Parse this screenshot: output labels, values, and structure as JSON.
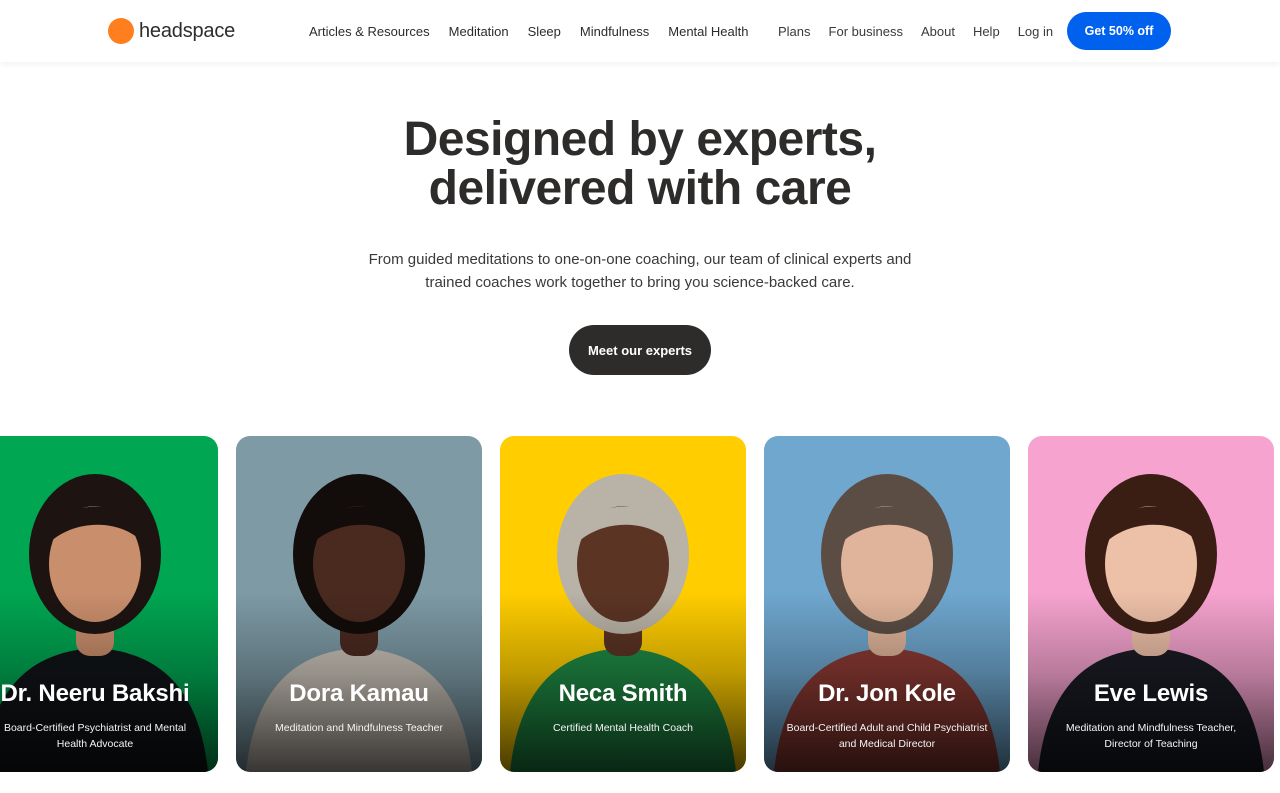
{
  "brand": {
    "name": "headspace",
    "logo_color": "#ff7e1d"
  },
  "nav": {
    "primary": [
      "Articles & Resources",
      "Meditation",
      "Sleep",
      "Mindfulness",
      "Mental Health"
    ],
    "utility": [
      "Plans",
      "For business",
      "About",
      "Help",
      "Log in"
    ],
    "cta_label": "Get 50% off",
    "cta_color": "#0061ef"
  },
  "hero": {
    "title_lines": [
      "Designed by experts,",
      "delivered with care"
    ],
    "subtitle_lines": [
      "From guided meditations to one-on-one coaching, our team of clinical experts and",
      "trained coaches work together to bring you science-backed care."
    ],
    "button_label": "Meet our experts"
  },
  "experts": [
    {
      "name": "Dr. Neeru Bakshi",
      "role_lines": [
        "Board-Certified Psychiatrist and Mental",
        "Health Advocate"
      ],
      "bg": "#00a651",
      "skin": "#c98e6c",
      "hair": "#1d1412",
      "shirt": "#111418"
    },
    {
      "name": "Dora Kamau",
      "role_lines": [
        "Meditation and Mindfulness Teacher"
      ],
      "bg": "#7d9aa5",
      "skin": "#4a2a1f",
      "hair": "#120c0a",
      "shirt": "#c9c2b8"
    },
    {
      "name": "Neca Smith",
      "role_lines": [
        "Certified Mental Health Coach"
      ],
      "bg": "#ffcd00",
      "skin": "#5b3424",
      "hair": "#b9b2a6",
      "shirt": "#1f8a44"
    },
    {
      "name": "Dr. Jon Kole",
      "role_lines": [
        "Board-Certified Adult and Child Psychiatrist",
        "and Medical Director"
      ],
      "bg": "#6fa7cf",
      "skin": "#e0b49a",
      "hair": "#5b4d44",
      "shirt": "#8c3a33"
    },
    {
      "name": "Eve Lewis",
      "role_lines": [
        "Meditation and Mindfulness Teacher,",
        "Director of Teaching"
      ],
      "bg": "#f6a3cf",
      "skin": "#edc0a8",
      "hair": "#3a1e14",
      "shirt": "#1a1c24"
    }
  ]
}
